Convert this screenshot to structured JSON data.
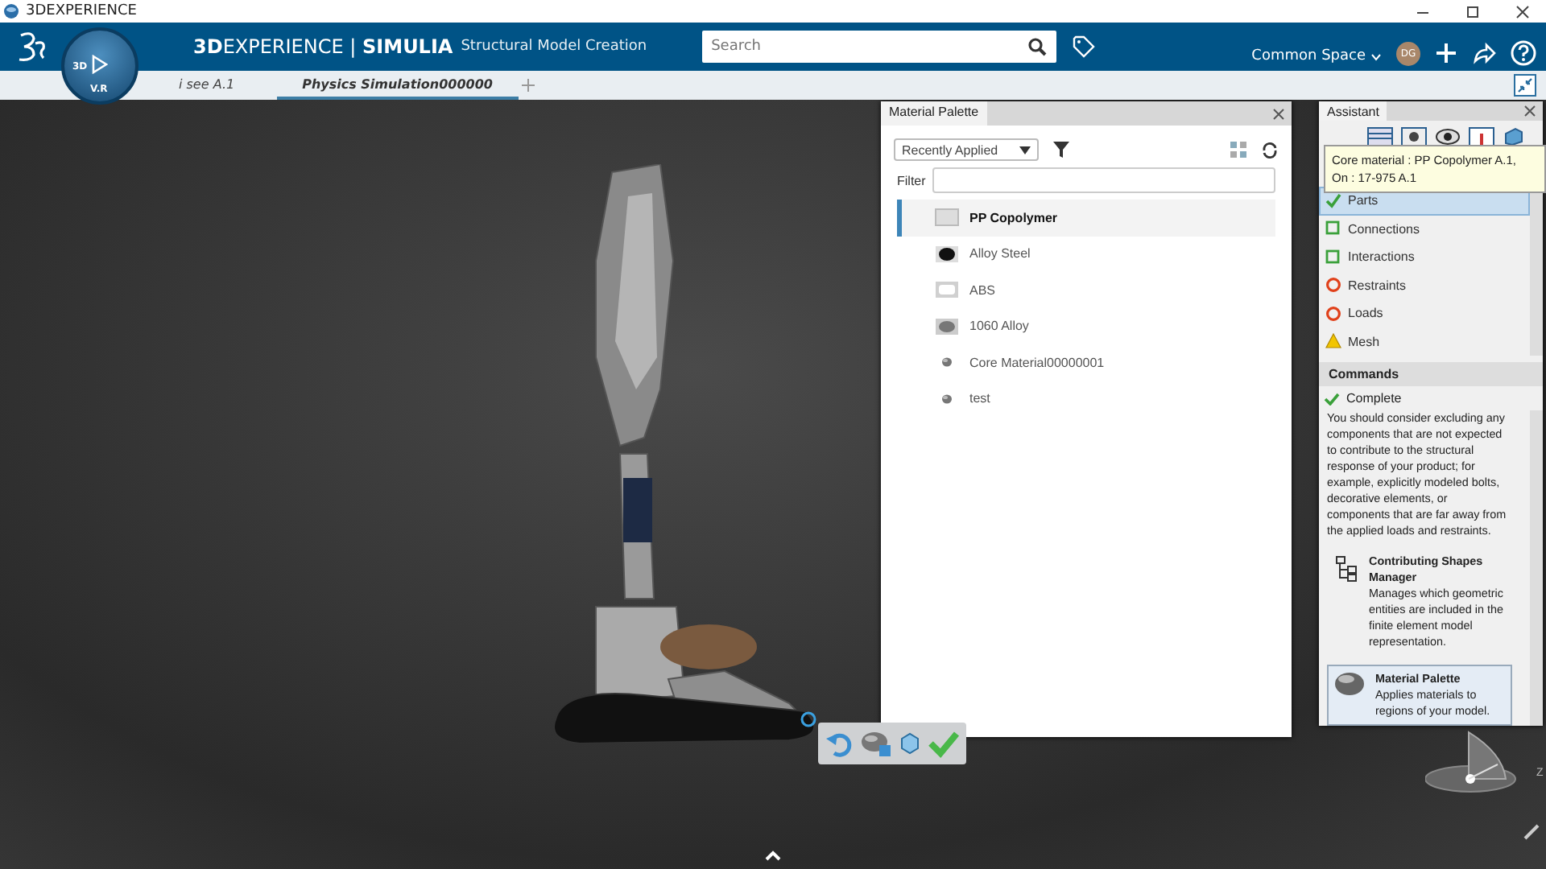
{
  "window": {
    "title": "3DEXPERIENCE"
  },
  "header": {
    "app_title": "**3D**EXPERIENCE | **SIMULIA**",
    "app_subtitle": "Structural Model Creation",
    "compass": {
      "left": "3D",
      "bottom": "V.R"
    },
    "search": {
      "placeholder": "Search"
    },
    "space": "Common Space",
    "avatar": "DG"
  },
  "tabs": [
    {
      "label": "i see A.1",
      "selected": false
    },
    {
      "label": "Physics Simulation000000",
      "selected": true
    }
  ],
  "material_palette": {
    "title": "Material Palette",
    "filter_dropdown": "Recently Applied",
    "filter_label": "Filter",
    "items": [
      {
        "name": "PP Copolymer",
        "kind": "light",
        "selected": true
      },
      {
        "name": "Alloy Steel",
        "kind": "dark",
        "selected": false
      },
      {
        "name": "ABS",
        "kind": "white",
        "selected": false
      },
      {
        "name": "1060 Alloy",
        "kind": "gray",
        "selected": false
      },
      {
        "name": "Core Material00000001",
        "kind": "small",
        "selected": false
      },
      {
        "name": "test",
        "kind": "small",
        "selected": false
      }
    ]
  },
  "view_compass": {
    "axis": "Z"
  },
  "assistant": {
    "title": "Assistant",
    "tooltip": [
      "Core material : PP Copolymer A.1,",
      "On : 17-975 A.1"
    ],
    "steps": [
      {
        "label": "Parts",
        "kind": "done",
        "selected": true
      },
      {
        "label": "Connections",
        "kind": "optional",
        "selected": false
      },
      {
        "label": "Interactions",
        "kind": "optional",
        "selected": false
      },
      {
        "label": "Restraints",
        "kind": "required",
        "selected": false
      },
      {
        "label": "Loads",
        "kind": "required",
        "selected": false
      },
      {
        "label": "Mesh",
        "kind": "warning",
        "selected": false
      }
    ],
    "commands_title": "Commands",
    "status": "Complete",
    "advice": "You should consider excluding any components that are not expected to contribute to the structural response of your product; for example, explicitly modeled bolts, decorative elements, or components that are far away from the applied loads and restraints.",
    "commands": [
      {
        "name": "Contributing Shapes Manager",
        "description": "Manages which geometric entities are included in the finite element model representation.",
        "kind": "shapes",
        "selected": false
      },
      {
        "name": "Material Palette",
        "description": "Applies materials to regions of your model.",
        "kind": "material",
        "selected": true
      }
    ]
  }
}
